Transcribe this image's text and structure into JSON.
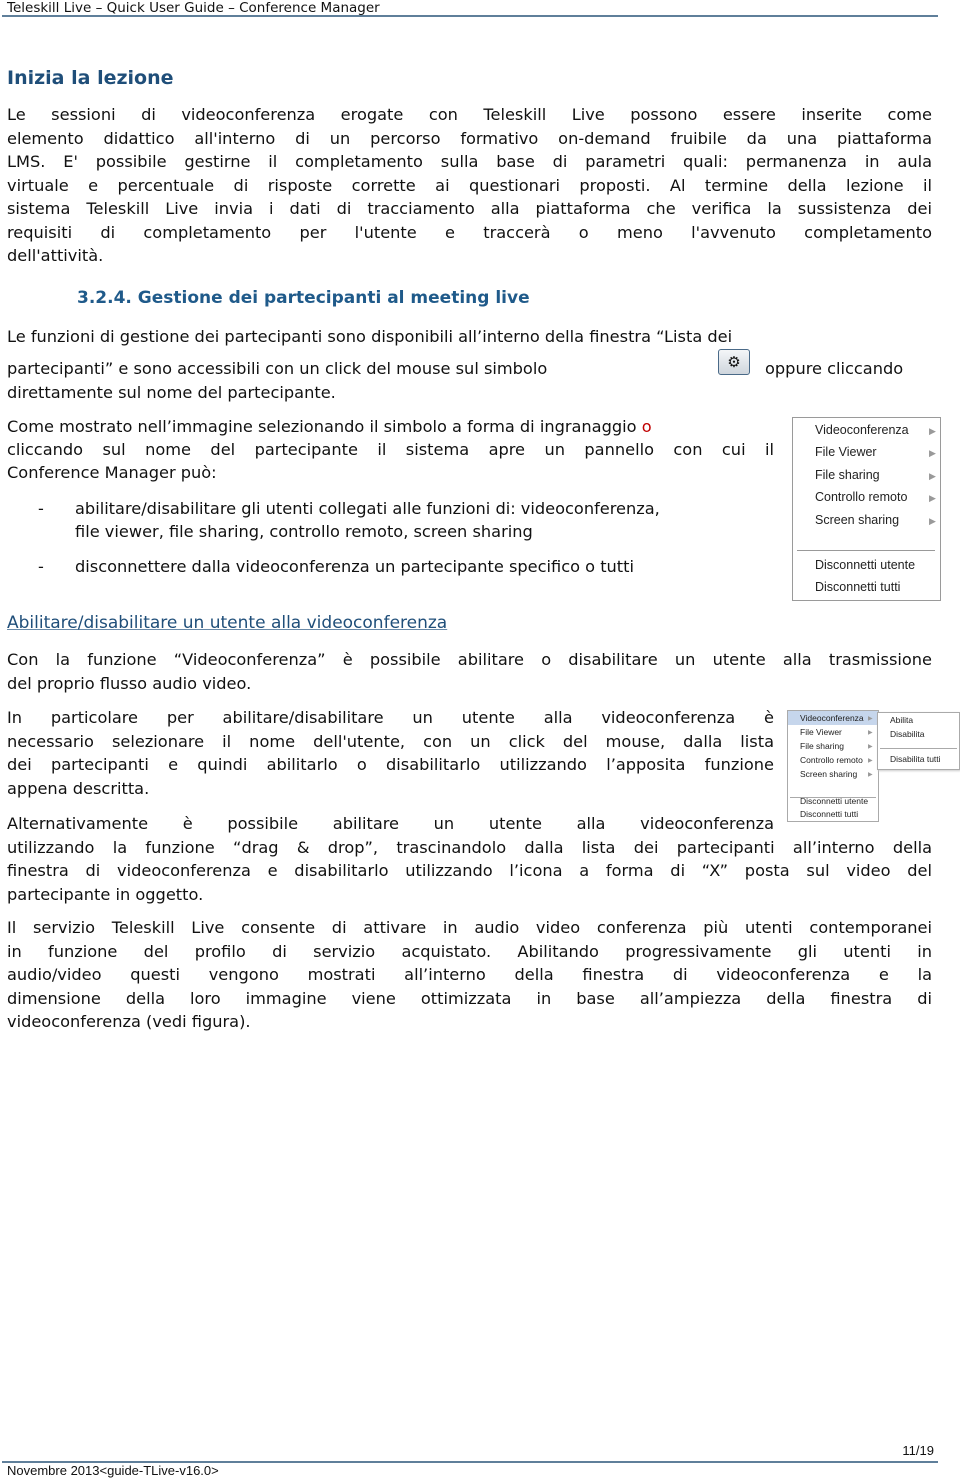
{
  "header": {
    "title": "Teleskill Live – Quick User Guide – Conference Manager"
  },
  "section1": {
    "heading": "Inizia la lezione",
    "paragraph_lines": [
      "Le sessioni di videoconferenza erogate con Teleskill Live possono essere inserite come",
      "elemento didattico all'interno di un percorso formativo on-demand fruibile da una piattaforma",
      "LMS. E' possibile gestirne il completamento sulla base di parametri quali: permanenza in aula",
      "virtuale e percentuale di risposte corrette ai questionari proposti. Al termine della lezione il",
      "sistema Teleskill Live invia i dati di tracciamento alla piattaforma che verifica la sussistenza dei",
      "requisiti di completamento per l'utente e traccerà o meno l'avvenuto completamento",
      "dell'attività."
    ]
  },
  "section2": {
    "heading": "3.2.4. Gestione dei partecipanti al meeting live",
    "intro_line1": "Le funzioni di gestione dei partecipanti sono disponibili all’interno della finestra “Lista dei",
    "intro_line2a": "partecipanti” e sono accessibili con un click del mouse sul simbolo",
    "intro_line2b": "oppure cliccando",
    "intro_line3": "direttamente sul nome del partecipante.",
    "gear_icon_name": "gear-icon",
    "para2_line1a": "Come mostrato nell’immagine selezionando il simbolo a forma di ingranaggio",
    "para2_line1b": "o",
    "para2_line2": "cliccando sul nome del partecipante il sistema apre un pannello con cui il",
    "para2_line3": "Conference Manager può:",
    "bullets": [
      {
        "dash": "-",
        "lines": [
          "abilitare/disabilitare gli utenti collegati alle funzioni di: videoconferenza,",
          "file viewer, file sharing, controllo remoto, screen sharing"
        ]
      },
      {
        "dash": "-",
        "lines": [
          "disconnettere dalla videoconferenza un partecipante specifico o tutti"
        ]
      }
    ],
    "menu": {
      "items": [
        "Videoconferenza",
        "File Viewer",
        "File sharing",
        "Controllo remoto",
        "Screen sharing"
      ],
      "arrow": "▶",
      "bottom_items": [
        "Disconnetti utente",
        "Disconnetti tutti"
      ]
    }
  },
  "section3": {
    "heading": "Abilitare/disabilitare un utente alla videoconferenza",
    "para1": [
      "Con la funzione “Videoconferenza” è possibile abilitare o disabilitare un utente alla trasmissione",
      "del proprio flusso audio video."
    ],
    "para2": [
      "In particolare per abilitare/disabilitare un utente alla videoconferenza è",
      "necessario selezionare il nome dell'utente, con un click del mouse, dalla lista",
      "dei partecipanti e quindi abilitarlo o disabilitarlo utilizzando l’apposita funzione",
      "appena descritta."
    ],
    "para3": [
      "Alternativamente è possibile abilitare un utente alla videoconferenza",
      "utilizzando la funzione “drag & drop”, trascinandolo dalla lista dei partecipanti all’interno della",
      "finestra di videoconferenza e disabilitarlo utilizzando l’icona a forma di “X” posta sul video del",
      "partecipante in oggetto."
    ],
    "para4": [
      "Il servizio Teleskill Live consente di attivare in audio video conferenza più utenti contemporanei",
      "in funzione del profilo di servizio acquistato. Abilitando progressivamente gli utenti in",
      "audio/video questi vengono mostrati all’interno della finestra di videoconferenza e la",
      "dimensione della loro immagine viene ottimizzata in base all’ampiezza della finestra di",
      "videoconferenza (vedi figura)."
    ],
    "menu": {
      "items": [
        "Videoconferenza",
        "File Viewer",
        "File sharing",
        "Controllo remoto",
        "Screen sharing"
      ],
      "highlighted": "Videoconferenza",
      "arrow": "▶",
      "bottom_items": [
        "Disconnetti utente",
        "Disconnetti tutti"
      ],
      "submenu": {
        "items": [
          "Abilita",
          "Disabilita"
        ],
        "bottom_items": [
          "Disabilita tutti"
        ]
      }
    }
  },
  "footer": {
    "page_number": "11/19",
    "text": "Novembre 2013<guide-TLive-v16.0>"
  },
  "colors": {
    "heading": "#1f4e79",
    "rule": "#5f7f9a",
    "accent_red": "#c00000"
  }
}
